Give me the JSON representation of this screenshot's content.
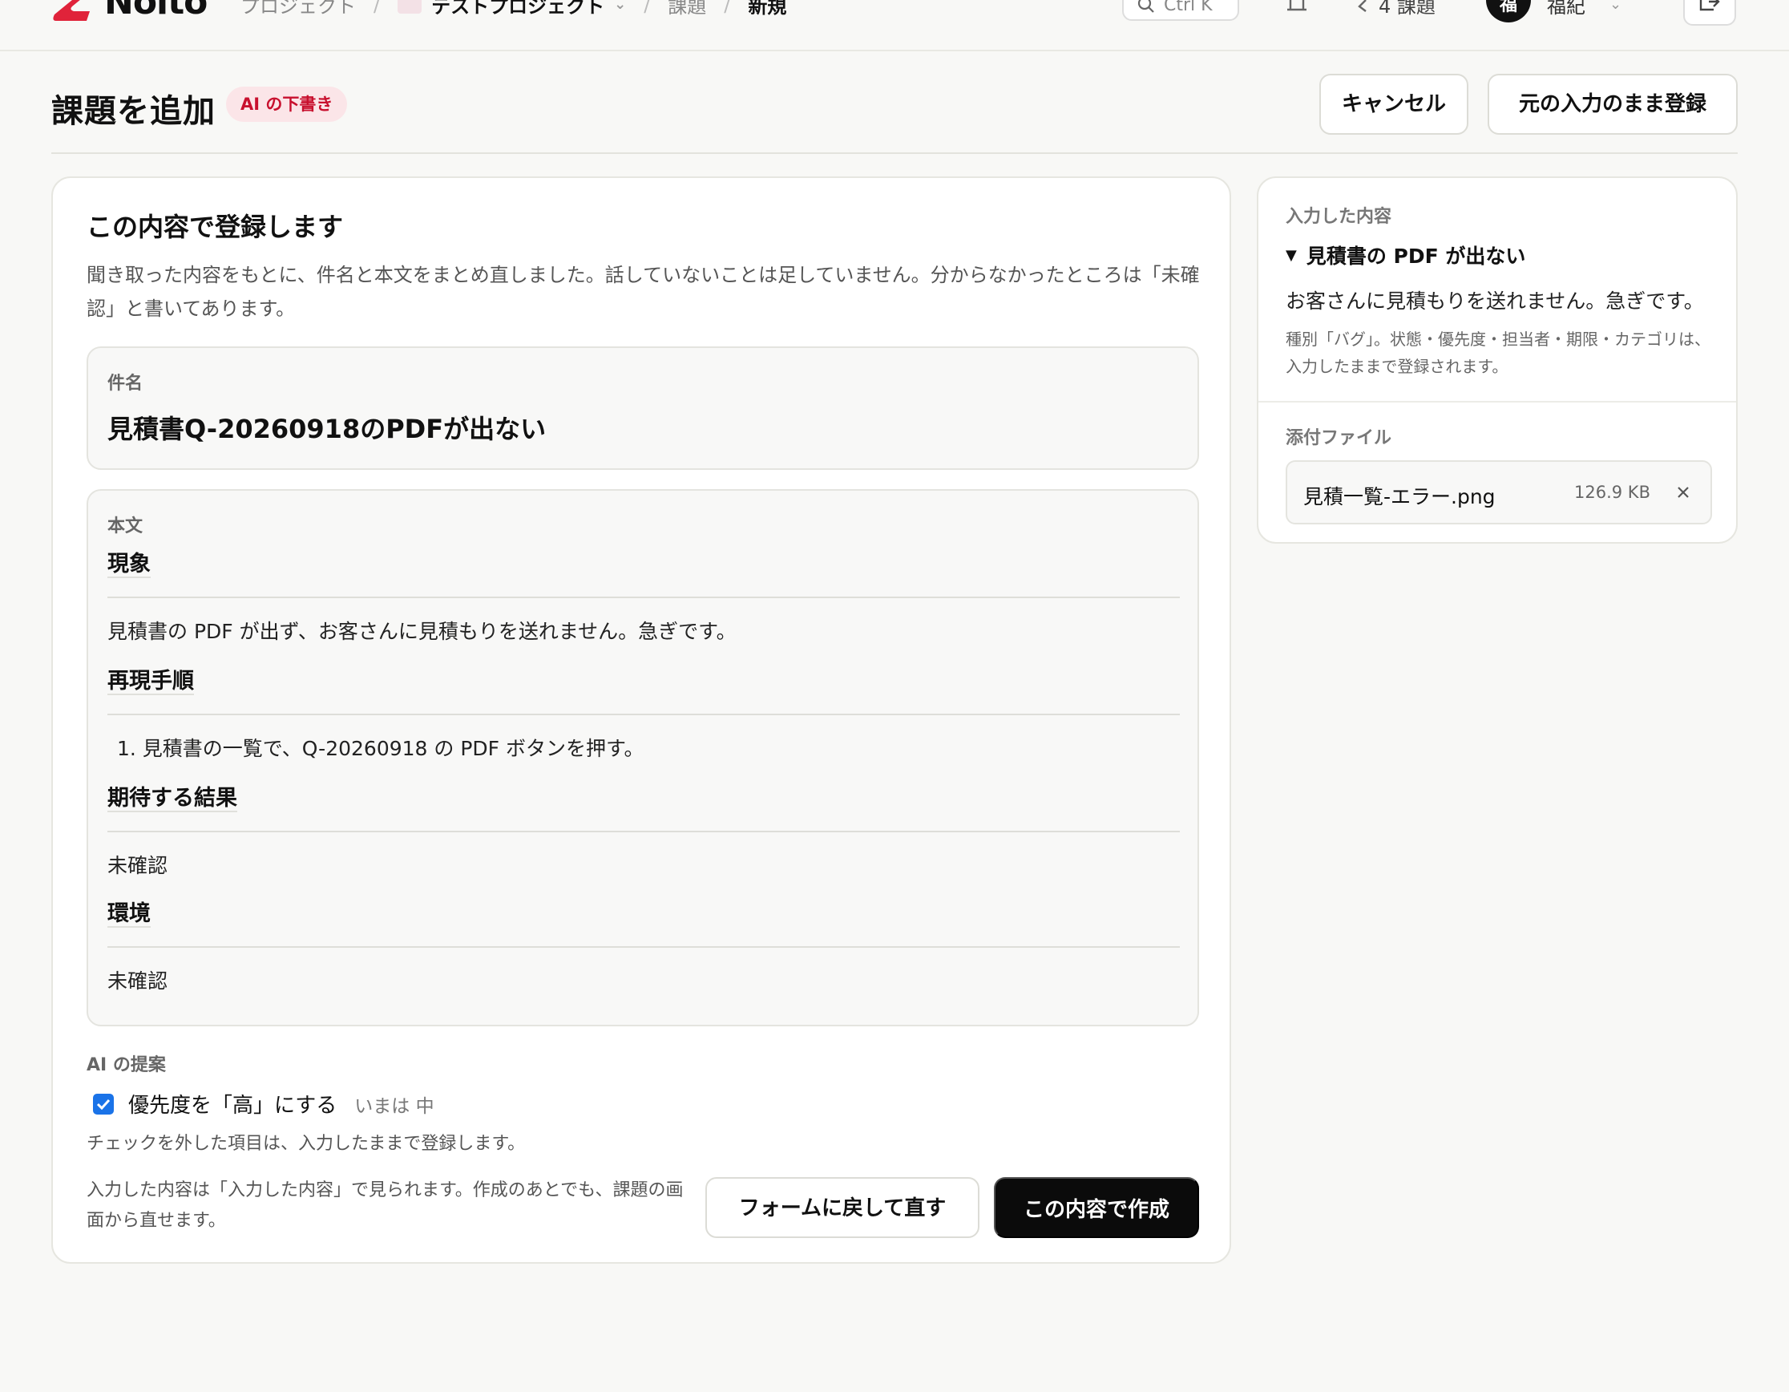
{
  "topbar": {
    "logo_text": "Noito",
    "crumb_projects": "プロジェクト",
    "project_name": "テストプロジェクト",
    "crumb_issues": "課題",
    "crumb_current": "新規",
    "search_placeholder": "Ctrl K",
    "my_tasks": "4 課題",
    "avatar_initial": "福",
    "user_name": "福紀"
  },
  "header": {
    "title": "課題を追加",
    "ai_badge": "AI の下書き",
    "cancel_label": "キャンセル",
    "register_raw_label": "元の入力のまま登録"
  },
  "main": {
    "title": "この内容で登録します",
    "description": "聞き取った内容をもとに、件名と本文をまとめ直しました。話していないことは足していません。分からなかったところは「未確認」と書いてあります。",
    "subject_label": "件名",
    "subject_value": "見積書Q-20260918のPDFが出ない",
    "body_label": "本文",
    "sections": [
      {
        "heading": "現象",
        "text": "見積書の PDF が出ず、お客さんに見積もりを送れません。急ぎです。"
      },
      {
        "heading": "再現手順",
        "text": "1. 見積書の一覧で、Q-20260918 の PDF ボタンを押す。"
      },
      {
        "heading": "期待する結果",
        "text": "未確認"
      },
      {
        "heading": "環境",
        "text": "未確認"
      }
    ],
    "ai_suggest_label": "AI の提案",
    "suggestion_text": "優先度を「高」にする",
    "suggestion_current": "いまは 中",
    "uncheck_note": "チェックを外した項目は、入力したままで登録します。",
    "footer_note": "入力した内容は「入力した内容」で見られます。作成のあとでも、課題の画面から直せます。",
    "back_form_label": "フォームに戻して直す",
    "create_label": "この内容で作成"
  },
  "side": {
    "input_label": "入力した内容",
    "input_subject": "見積書の PDF が出ない",
    "input_body": "お客さんに見積もりを送れません。急ぎです。",
    "input_note": "種別「バグ」。状態・優先度・担当者・期限・カテゴリは、入力したままで登録されます。",
    "attach_label": "添付ファイル",
    "file_name": "見積一覧-エラー.png",
    "file_size": "126.9 KB"
  },
  "colors": {
    "brand": "#e0233a",
    "accent_badge_bg": "#fbe5e8",
    "primary_button": "#0b0b0b",
    "checkbox": "#1a73e8"
  },
  "icons": [
    "logo-mark-icon",
    "search-icon",
    "bell-icon",
    "my-tasks-icon",
    "chevron-down-icon",
    "logout-icon",
    "triangle-down-icon",
    "close-icon",
    "check-icon"
  ]
}
